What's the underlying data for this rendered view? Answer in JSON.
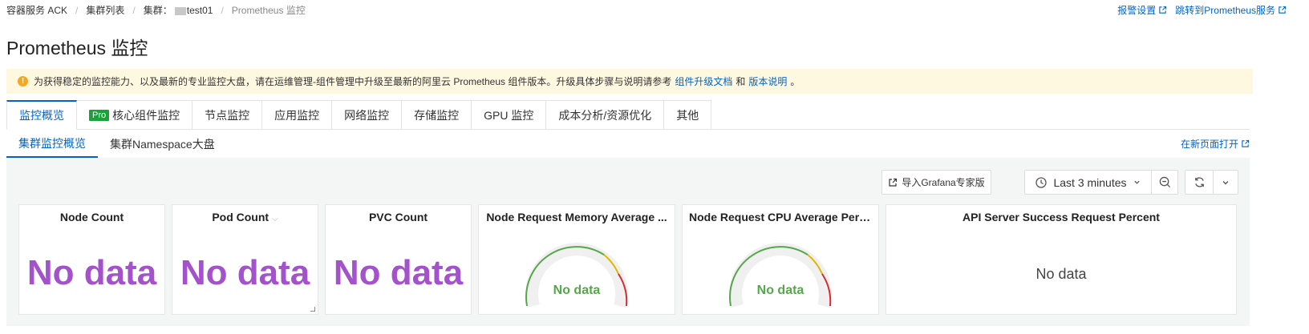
{
  "breadcrumb": {
    "items": [
      "容器服务 ACK",
      "集群列表"
    ],
    "cluster_prefix": "集群：",
    "cluster_name": "test01",
    "current": "Prometheus 监控"
  },
  "top_links": {
    "alert_settings": "报警设置",
    "goto_prometheus": "跳转到Prometheus服务"
  },
  "page_title": "Prometheus 监控",
  "alert": {
    "text_before": "为获得稳定的监控能力、以及最新的专业监控大盘，请在运维管理-组件管理中升级至最新的阿里云 Prometheus 组件版本。升级具体步骤与说明请参考",
    "link1": "组件升级文档",
    "middle": "和",
    "link2": "版本说明",
    "text_after": "。"
  },
  "tabs": [
    {
      "label": "监控概览",
      "active": true
    },
    {
      "label": "核心组件监控",
      "badge": "Pro"
    },
    {
      "label": "节点监控"
    },
    {
      "label": "应用监控"
    },
    {
      "label": "网络监控"
    },
    {
      "label": "存储监控"
    },
    {
      "label": "GPU 监控"
    },
    {
      "label": "成本分析/资源优化"
    },
    {
      "label": "其他"
    }
  ],
  "subtabs": [
    {
      "label": "集群监控概览",
      "active": true
    },
    {
      "label": "集群Namespace大盘"
    }
  ],
  "open_new_page": "在新页面打开",
  "toolbar": {
    "grafana_import": "导入Grafana专家版",
    "time_range": "Last 3 minutes"
  },
  "panels": [
    {
      "title": "Node Count",
      "value": "No data"
    },
    {
      "title": "Pod Count",
      "value": "No data"
    },
    {
      "title": "PVC Count",
      "value": "No data"
    },
    {
      "title": "Node Request Memory Average ...",
      "value": "No data"
    },
    {
      "title": "Node Request CPU Average Perc...",
      "value": "No data"
    },
    {
      "title": "API Server Success Request Percent",
      "value": "No data"
    }
  ],
  "colors": {
    "primary": "#0064c8",
    "nodata_purple": "#a352cc",
    "gauge_green": "#56a64b",
    "gauge_yellow": "#e0b400",
    "gauge_red": "#d8292f",
    "alert_bg": "#fff8e1"
  }
}
